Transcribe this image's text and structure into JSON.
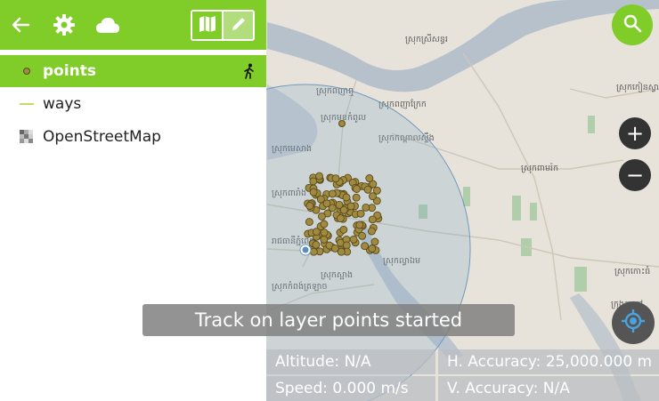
{
  "toolbar": {
    "back_icon": "arrow-left-icon",
    "settings_icon": "gear-icon",
    "cloud_icon": "cloud-icon",
    "browse_mode_icon": "map-icon",
    "digitize_mode_icon": "pencil-icon",
    "accent": "#80cc28"
  },
  "layers": [
    {
      "label": "points",
      "icon": "point-layer-icon",
      "active": true,
      "tracking_icon": "walking-person-icon"
    },
    {
      "label": "ways",
      "icon": "line-layer-icon",
      "active": false
    },
    {
      "label": "OpenStreetMap",
      "icon": "raster-layer-icon",
      "active": false
    }
  ],
  "map_labels": [
    "ស្រុកស្រីសន្ធរ",
    "ស្រុកកៀនស្វាយ",
    "ស្រុកពញាឮ",
    "ស្រុកមុខកំពូល",
    "ស្រុកពញាក្រែក",
    "ស្រុកកណ្ដាលស្ទឹង",
    "ស្រុកពាមរ៉ក",
    "ស្រុកល្វាឯម",
    "ស្រុកស្អាង",
    "ស្រុកកោះធំ",
    "ស្រុកកំពង់ត្រឡាច",
    "ក្រុងតាខ្មៅ",
    "រាជធានីភ្នំពេញ",
    "ស្រុកមេសាង",
    "ស្រុកពារាំង"
  ],
  "map_controls": {
    "search_icon": "search-icon",
    "zoom_in_label": "+",
    "zoom_out_label": "−",
    "locate_icon": "gps-locate-icon"
  },
  "toast": {
    "message": "Track on layer points started"
  },
  "position_info": {
    "altitude": "Altitude: N/A",
    "speed": "Speed: 0.000 m/s",
    "h_accuracy": "H. Accuracy: 25,000.000 m",
    "v_accuracy": "V. Accuracy: N/A"
  }
}
